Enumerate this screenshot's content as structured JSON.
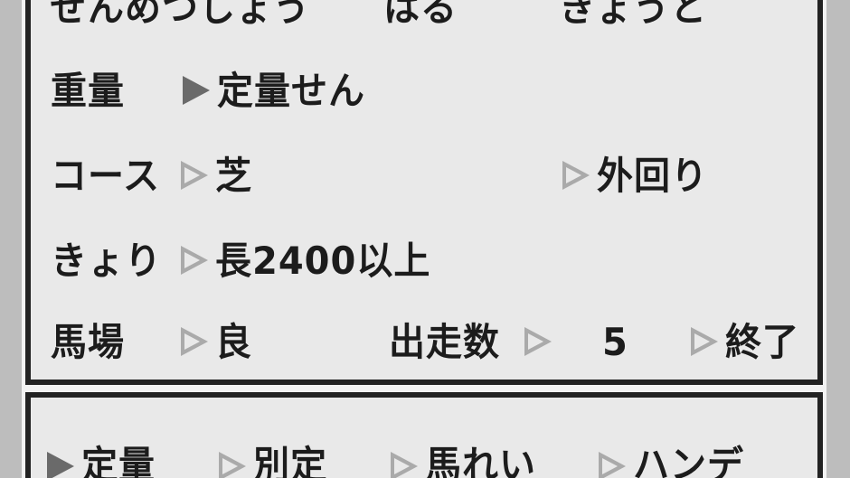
{
  "info": {
    "header_label": "ぜんめつしょう",
    "season": "はる",
    "location": "きょうと"
  },
  "rows": {
    "grade": {
      "label": "重量",
      "value": "定量せん"
    },
    "course": {
      "label": "コース",
      "value": "芝",
      "direction": "外回り"
    },
    "distance": {
      "label": "きょり",
      "value": "長2400以上"
    },
    "track": {
      "label": "馬場",
      "value": "良",
      "runners_label": "出走数",
      "runners_value": "5",
      "end_label": "終了"
    }
  },
  "bottom_menu": {
    "items": [
      {
        "label": "定量"
      },
      {
        "label": "別定"
      },
      {
        "label": "馬れい"
      },
      {
        "label": "ハンデ"
      }
    ]
  },
  "cursor_icons": {
    "active": "filled-triangle-cursor",
    "inactive": "hollow-triangle-cursor"
  },
  "colors": {
    "panel_bg": "#e9e9e9",
    "border": "#222222",
    "text": "#1c1c1c",
    "cursor_inactive": "#aaaaaa",
    "cursor_active": "#6a6a6a"
  }
}
